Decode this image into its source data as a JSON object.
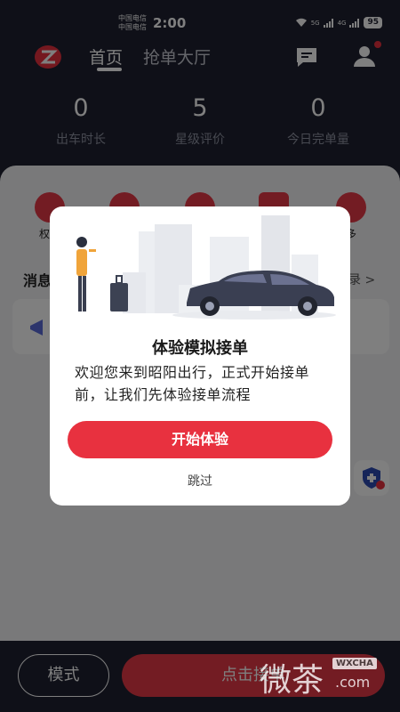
{
  "status_bar": {
    "carrier_1": "中国电信",
    "carrier_2": "中国电信",
    "time": "2:00",
    "net_1": "5G",
    "net_2": "4G",
    "battery": "95"
  },
  "nav": {
    "tab_home": "首页",
    "tab_hall": "抢单大厅",
    "icons": [
      "logo-icon",
      "message-icon",
      "user-icon"
    ]
  },
  "stats": [
    {
      "value": "0",
      "label": "出车时长"
    },
    {
      "value": "5",
      "label": "星级评价"
    },
    {
      "value": "0",
      "label": "今日完单量"
    }
  ],
  "functions": {
    "first_label": "权益",
    "last_label": "多"
  },
  "section": {
    "title": "消息",
    "more": "录 >"
  },
  "dialog": {
    "title": "体验模拟接单",
    "body": "欢迎您来到昭阳出行，正式开始接单前，让我们先体验接单流程",
    "start_button": "开始体验",
    "skip": "跳过"
  },
  "bottom": {
    "mode_button": "模式",
    "grab_button": "点击接单"
  },
  "watermark": {
    "big": "微茶",
    "tag": "WXCHA",
    "sub": ".com"
  },
  "colors": {
    "accent": "#e8313f",
    "dark": "#1f2130"
  }
}
